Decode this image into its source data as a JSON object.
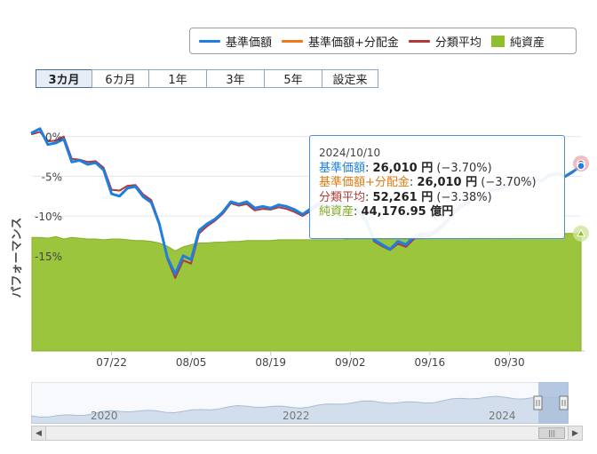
{
  "legend": {
    "items": [
      {
        "label": "基準価額",
        "color": "#1e7fe0"
      },
      {
        "label": "基準価額+分配金",
        "color": "#f07a1a"
      },
      {
        "label": "分類平均",
        "color": "#b03a3a"
      },
      {
        "label": "純資産",
        "color": "#8fbe2e"
      }
    ]
  },
  "range_buttons": [
    "3カ月",
    "6カ月",
    "1年",
    "3年",
    "5年",
    "設定来"
  ],
  "active_range": "3カ月",
  "tooltip": {
    "date": "2024/10/10",
    "rows": [
      {
        "label": "基準価額",
        "sep": ": ",
        "value": "26,010 円",
        "change": " (−3.70%)",
        "color": "#1e7fe0"
      },
      {
        "label": "基準価額+分配金",
        "sep": ": ",
        "value": "26,010 円",
        "change": " (−3.70%)",
        "color": "#e07a10"
      },
      {
        "label": "分類平均",
        "sep": ": ",
        "value": "52,261 円",
        "change": " (−3.38%)",
        "color": "#b03a3a"
      },
      {
        "label": "純資産",
        "sep": ": ",
        "value": "44,176.95 億円",
        "change": "",
        "color": "#7eaa1e"
      }
    ]
  },
  "navigator": {
    "year_labels": [
      "2020",
      "2022",
      "2024"
    ]
  },
  "colors": {
    "nav_fill": "#c9d6e6",
    "nav_selected": "#a9bfdc",
    "net_assets_fill": "#9bc53d"
  },
  "chart_data": {
    "type": "line",
    "ylabel": "パフォーマンス",
    "ylim": [
      -27.0,
      4.0
    ],
    "y_ticks": [
      0,
      -5,
      -10,
      -15
    ],
    "y_tick_labels": [
      "0%",
      "-5%",
      "-10%",
      "-15%"
    ],
    "x_tick_labels": [
      "07/22",
      "08/05",
      "08/19",
      "09/02",
      "09/16",
      "09/30"
    ],
    "x_tick_index": [
      10,
      20,
      30,
      40,
      50,
      60
    ],
    "series": [
      {
        "name": "基準価額",
        "color": "#1e7fe0",
        "values": [
          0.5,
          1.0,
          -1.0,
          -0.8,
          -0.3,
          -3.2,
          -3.0,
          -3.5,
          -3.3,
          -4.2,
          -7.2,
          -7.5,
          -6.5,
          -6.3,
          -7.6,
          -8.3,
          -11.0,
          -15.2,
          -17.3,
          -15.0,
          -15.5,
          -11.8,
          -11.0,
          -10.4,
          -9.5,
          -8.2,
          -8.5,
          -8.2,
          -9.0,
          -8.8,
          -9.0,
          -8.6,
          -8.8,
          -9.2,
          -9.8,
          -9.1,
          -8.4,
          -8.7,
          -8.6,
          -8.3,
          -8.9,
          -9.2,
          -10.5,
          -13.0,
          -13.6,
          -14.2,
          -13.2,
          -13.6,
          -12.6,
          -12.2,
          -12.3,
          -11.6,
          -10.7,
          -9.4,
          -8.6,
          -8.0,
          -7.5,
          -7.1,
          -6.6,
          -6.4,
          -6.0,
          -5.7,
          -5.4,
          -5.4,
          -5.6,
          -4.8,
          -4.6,
          -5.0,
          -4.4,
          -3.7
        ]
      },
      {
        "name": "分類平均",
        "color": "#b03a3a",
        "values": [
          0.3,
          0.6,
          -0.6,
          -0.5,
          0.0,
          -2.8,
          -2.9,
          -3.2,
          -3.1,
          -3.9,
          -6.7,
          -6.8,
          -6.2,
          -6.1,
          -7.3,
          -8.0,
          -10.8,
          -15.4,
          -17.8,
          -15.6,
          -16.0,
          -12.2,
          -11.3,
          -10.6,
          -9.7,
          -8.4,
          -8.7,
          -8.5,
          -9.3,
          -9.1,
          -9.2,
          -8.9,
          -9.1,
          -9.5,
          -10.0,
          -9.4,
          -8.7,
          -9.0,
          -8.8,
          -8.6,
          -9.2,
          -9.5,
          -10.8,
          -13.2,
          -13.8,
          -14.3,
          -13.5,
          -13.9,
          -12.9,
          -12.5,
          -12.6,
          -11.9,
          -11.0,
          -9.7,
          -8.9,
          -8.3,
          -7.8,
          -7.3,
          -6.8,
          -6.6,
          -6.2,
          -5.9,
          -5.6,
          -5.5,
          -5.7,
          -5.0,
          -4.8,
          -5.1,
          -4.5,
          -3.4
        ]
      },
      {
        "name": "純資産",
        "color": "#9bc53d",
        "values": [
          -12.7,
          -12.7,
          -12.8,
          -12.6,
          -12.9,
          -12.7,
          -12.8,
          -12.9,
          -12.9,
          -13.0,
          -12.9,
          -12.9,
          -13.0,
          -13.1,
          -13.1,
          -13.2,
          -13.4,
          -13.8,
          -14.4,
          -13.9,
          -13.6,
          -13.4,
          -13.4,
          -13.3,
          -13.3,
          -13.2,
          -13.2,
          -13.1,
          -13.1,
          -13.1,
          -13.1,
          -13.0,
          -13.0,
          -13.0,
          -13.0,
          -13.0,
          -13.0,
          -13.0,
          -13.0,
          -13.0,
          -12.9,
          -12.9,
          -12.9,
          -12.9,
          -12.9,
          -12.9,
          -12.9,
          -12.9,
          -12.9,
          -12.9,
          -12.8,
          -12.8,
          -12.8,
          -12.8,
          -12.7,
          -12.7,
          -12.6,
          -12.6,
          -12.6,
          -12.5,
          -12.5,
          -12.4,
          -12.4,
          -12.4,
          -12.3,
          -12.3,
          -12.2,
          -12.2,
          -12.2,
          -12.2
        ]
      }
    ]
  }
}
